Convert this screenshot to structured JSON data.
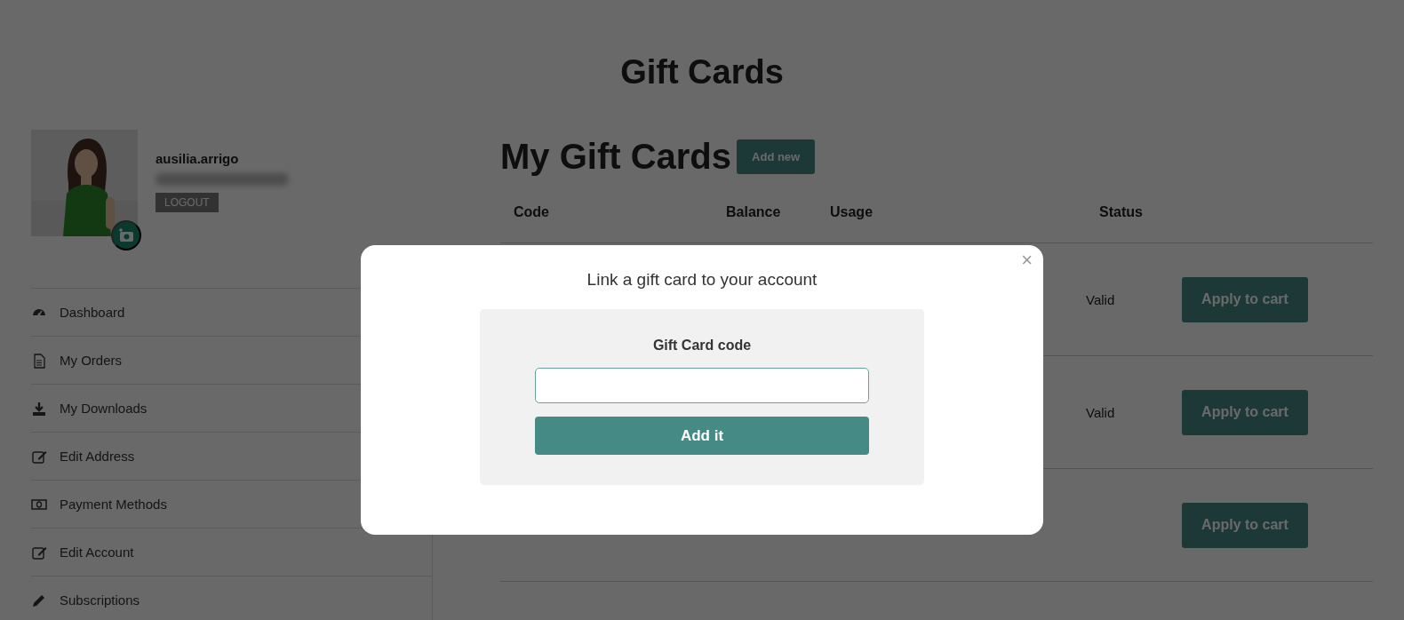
{
  "page_title": "Gift Cards",
  "profile": {
    "username": "ausilia.arrigo",
    "logout": "LOGOUT"
  },
  "menu": [
    {
      "label": "Dashboard"
    },
    {
      "label": "My Orders"
    },
    {
      "label": "My Downloads"
    },
    {
      "label": "Edit Address"
    },
    {
      "label": "Payment Methods"
    },
    {
      "label": "Edit Account"
    },
    {
      "label": "Subscriptions"
    }
  ],
  "section_title": "My Gift Cards",
  "add_new": "Add new",
  "table": {
    "columns": [
      "Code",
      "Balance",
      "Usage",
      "Status"
    ],
    "rows": [
      {
        "status": "Valid",
        "action": "Apply to cart"
      },
      {
        "status": "Valid",
        "action": "Apply to cart"
      },
      {
        "action": "Apply to cart"
      }
    ]
  },
  "modal": {
    "title": "Link a gift card to your account",
    "field_label": "Gift Card code",
    "submit": "Add it",
    "close": "×"
  }
}
